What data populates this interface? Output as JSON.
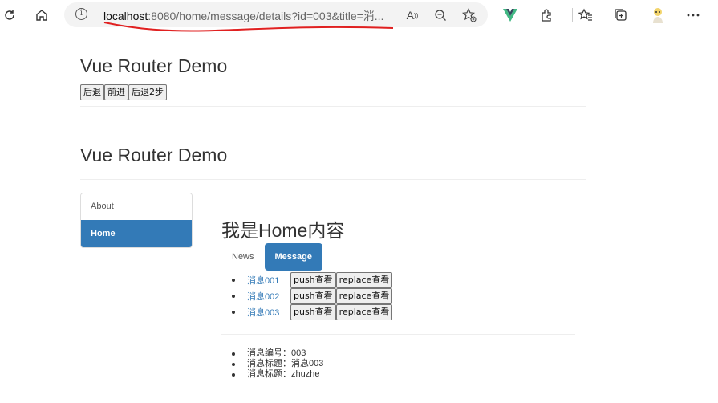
{
  "browser": {
    "url_host": "localhost",
    "url_rest": ":8080/home/message/details?id=003&title=消...",
    "accent_underline_color": "#e02020"
  },
  "page": {
    "title_1": "Vue Router Demo",
    "title_2": "Vue Router Demo",
    "nav_buttons": [
      "后退",
      "前进",
      "后退2步"
    ],
    "sidebar": [
      {
        "label": "About",
        "active": false
      },
      {
        "label": "Home",
        "active": true
      }
    ],
    "home_title": "我是Home内容",
    "tabs": [
      {
        "label": "News",
        "active": false
      },
      {
        "label": "Message",
        "active": true
      }
    ],
    "messages": [
      {
        "link": "消息001",
        "push": "push查看",
        "replace": "replace查看"
      },
      {
        "link": "消息002",
        "push": "push查看",
        "replace": "replace查看"
      },
      {
        "link": "消息003",
        "push": "push查看",
        "replace": "replace查看"
      }
    ],
    "details": [
      "消息编号：003",
      "消息标题：消息003",
      "消息标题：zhuzhe"
    ],
    "accent_color": "#337ab7"
  }
}
